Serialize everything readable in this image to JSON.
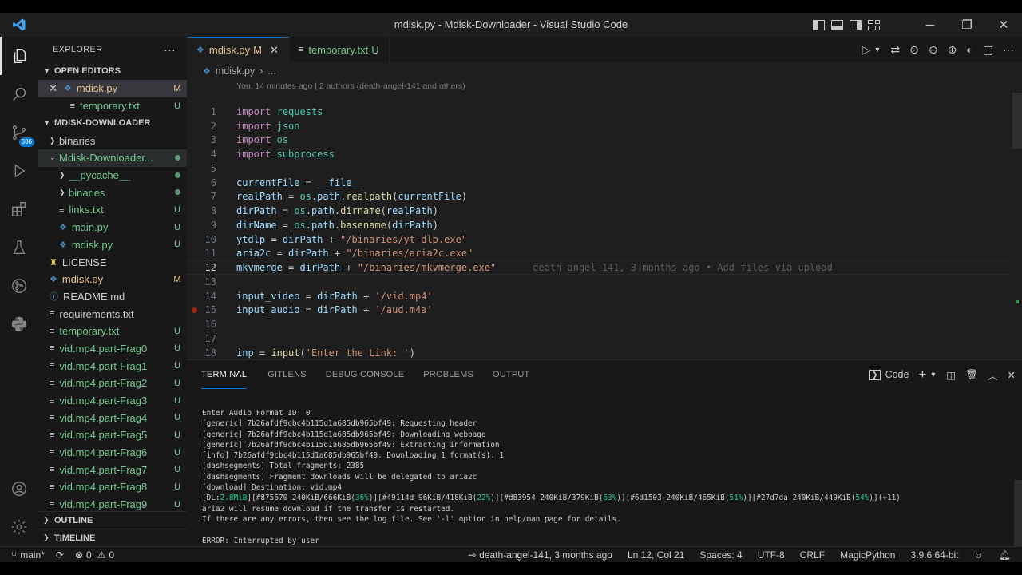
{
  "window": {
    "title": "mdisk.py - Mdisk-Downloader - Visual Studio Code"
  },
  "activity": {
    "scm_badge": "336"
  },
  "explorer": {
    "header": "EXPLORER",
    "more": "···",
    "open_editors_title": "OPEN EDITORS",
    "open_editors": [
      {
        "name": "mdisk.py",
        "status": "M"
      },
      {
        "name": "temporary.txt",
        "status": "U"
      }
    ],
    "folder_title": "MDISK-DOWNLOADER",
    "tree": [
      {
        "name": "binaries",
        "status": ""
      },
      {
        "name": "Mdisk-Downloader...",
        "status": ""
      },
      {
        "name": "__pycache__",
        "status": ""
      },
      {
        "name": "binaries",
        "status": ""
      },
      {
        "name": "links.txt",
        "status": "U"
      },
      {
        "name": "main.py",
        "status": "U"
      },
      {
        "name": "mdisk.py",
        "status": "U"
      },
      {
        "name": "LICENSE",
        "status": ""
      },
      {
        "name": "mdisk.py",
        "status": "M"
      },
      {
        "name": "README.md",
        "status": ""
      },
      {
        "name": "requirements.txt",
        "status": ""
      },
      {
        "name": "temporary.txt",
        "status": "U"
      },
      {
        "name": "vid.mp4.part-Frag0",
        "status": "U"
      },
      {
        "name": "vid.mp4.part-Frag1",
        "status": "U"
      },
      {
        "name": "vid.mp4.part-Frag2",
        "status": "U"
      },
      {
        "name": "vid.mp4.part-Frag3",
        "status": "U"
      },
      {
        "name": "vid.mp4.part-Frag4",
        "status": "U"
      },
      {
        "name": "vid.mp4.part-Frag5",
        "status": "U"
      },
      {
        "name": "vid.mp4.part-Frag6",
        "status": "U"
      },
      {
        "name": "vid.mp4.part-Frag7",
        "status": "U"
      },
      {
        "name": "vid.mp4.part-Frag8",
        "status": "U"
      },
      {
        "name": "vid.mp4.part-Frag9",
        "status": "U"
      }
    ],
    "outline_title": "OUTLINE",
    "timeline_title": "TIMELINE"
  },
  "editor": {
    "tabs": [
      {
        "name": "mdisk.py",
        "status": "M",
        "close": "✕"
      },
      {
        "name": "temporary.txt",
        "status": "U"
      }
    ],
    "breadcrumb": {
      "file": "mdisk.py",
      "sep": "›",
      "rest": "..."
    },
    "blame_header": "You, 14 minutes ago | 2 authors (death-angel-141 and others)",
    "line_numbers": [
      "1",
      "2",
      "3",
      "4",
      "5",
      "6",
      "7",
      "8",
      "9",
      "10",
      "11",
      "12",
      "13",
      "14",
      "15",
      "16",
      "17",
      "18"
    ],
    "blame_line12": "death-angel-141, 3 months ago • Add files via upload"
  },
  "panel": {
    "tabs": [
      "TERMINAL",
      "GITLENS",
      "DEBUG CONSOLE",
      "PROBLEMS",
      "OUTPUT"
    ],
    "shell": "Code",
    "terminal_lines": [
      "Enter Audio Format ID: 0",
      "[generic] 7b26afdf9cbc4b115d1a685db965bf49: Requesting header",
      "[generic] 7b26afdf9cbc4b115d1a685db965bf49: Downloading webpage",
      "[generic] 7b26afdf9cbc4b115d1a685db965bf49: Extracting information",
      "[info] 7b26afdf9cbc4b115d1a685db965bf49: Downloading 1 format(s): 1",
      "[dashsegments] Total fragments: 2385",
      "[dashsegments] Fragment downloads will be delegated to aria2c",
      "[download] Destination: vid.mp4"
    ],
    "dl_line": {
      "a": "[DL:",
      "b": "2.8MiB",
      "c": "][#875670 240KiB/666KiB(",
      "d": "36%",
      "e": ")][#49114d 96KiB/418KiB(",
      "f": "22%",
      "g": ")][#d83954 240KiB/379KiB(",
      "h": "63%",
      "i": ")][#6d1503 240KiB/465KiB(",
      "j": "51%",
      "k": ")][#27d7da 240KiB/440KiB(",
      "l": "54%",
      "m": ")](+11)"
    },
    "after_lines": [
      "aria2 will resume download if the transfer is restarted.",
      "If there are any errors, then see the log file. See '-l' option in help/man page for details."
    ],
    "error_line": "ERROR: Interrupted by user"
  },
  "status": {
    "branch": "main*",
    "errors": "0",
    "warnings": "0",
    "blame": "death-angel-141, 3 months ago",
    "position": "Ln 12, Col 21",
    "spaces": "Spaces: 4",
    "encoding": "UTF-8",
    "eol": "CRLF",
    "language": "MagicPython",
    "interpreter": "3.9.6 64-bit"
  },
  "colors": {
    "accent": "#0078d4",
    "modified": "#e2c08d",
    "untracked": "#73c991",
    "status_blue": "#3794ff"
  }
}
